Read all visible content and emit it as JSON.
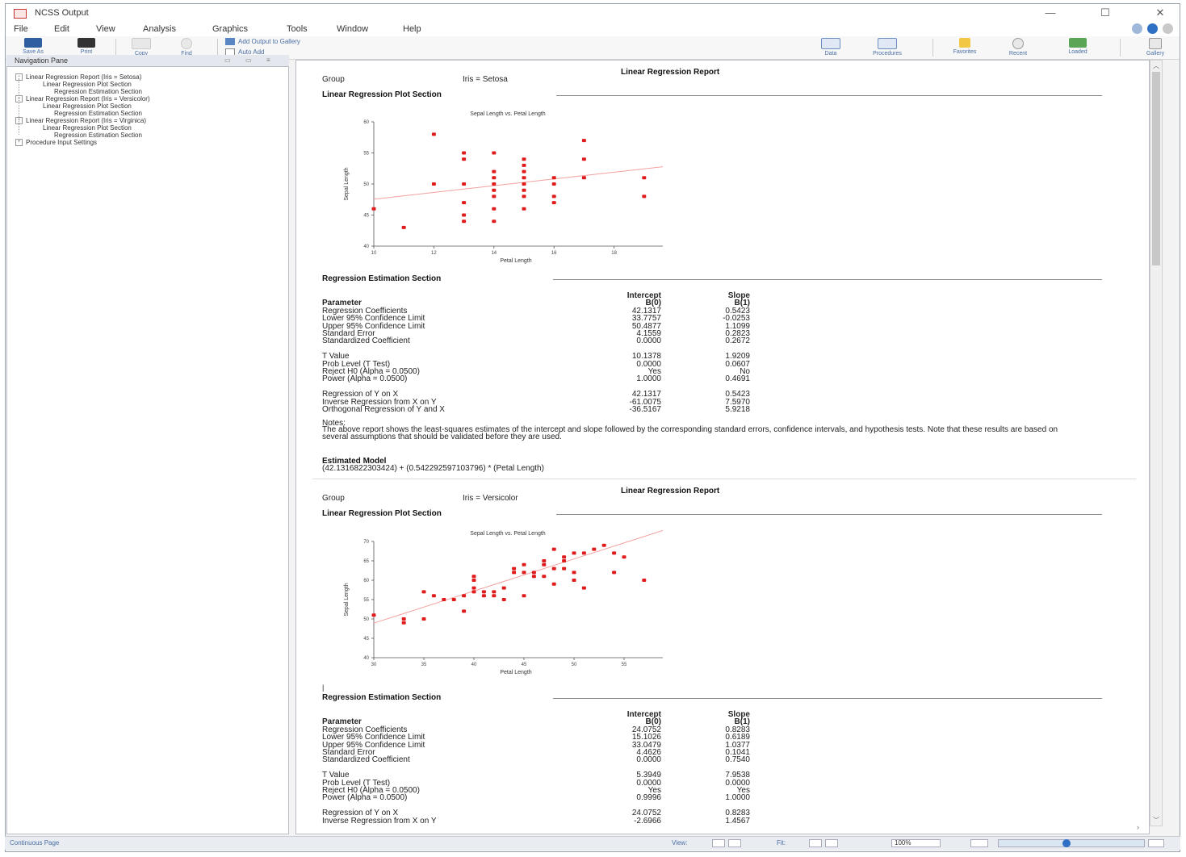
{
  "window": {
    "title": "NCSS Output",
    "controls": [
      "—",
      "☐",
      "✕"
    ]
  },
  "menu": [
    "File",
    "Edit",
    "View",
    "Analysis",
    "Graphics",
    "Tools",
    "Window",
    "Help"
  ],
  "toolbar": {
    "save_as": "Save As",
    "print": "Print",
    "copy": "Copy",
    "find": "Find",
    "add_output": "Add Output to Gallery",
    "auto_add": "Auto Add",
    "data": "Data",
    "procedures": "Procedures",
    "favorites": "Favorites",
    "recent": "Recent",
    "loaded": "Loaded",
    "gallery": "Gallery"
  },
  "nav": {
    "title": "Navigation Pane",
    "items": [
      "Linear Regression Report (Iris = Setosa)",
      "Linear Regression Plot Section",
      "Regression Estimation Section",
      "Linear Regression Report (Iris = Versicolor)",
      "Linear Regression Plot Section",
      "Regression Estimation Section",
      "Linear Regression Report (Iris = Virginica)",
      "Linear Regression Plot Section",
      "Regression Estimation Section",
      "Procedure Input Settings"
    ]
  },
  "reports": [
    {
      "title": "Linear Regression Report",
      "group_label": "Group",
      "group_value": "Iris = Setosa",
      "plot_section": "Linear Regression Plot Section",
      "est_section": "Regression Estimation Section",
      "param_header": "Parameter",
      "col1_header": [
        "Intercept",
        "B(0)"
      ],
      "col2_header": [
        "Slope",
        "B(1)"
      ],
      "rows": [
        [
          "Regression Coefficients",
          "42.1317",
          "0.5423"
        ],
        [
          "Lower 95% Confidence Limit",
          "33.7757",
          "-0.0253"
        ],
        [
          "Upper 95% Confidence Limit",
          "50.4877",
          "1.1099"
        ],
        [
          "Standard Error",
          "4.1559",
          "0.2823"
        ],
        [
          "Standardized Coefficient",
          "0.0000",
          "0.2672"
        ],
        [
          "",
          "",
          ""
        ],
        [
          "T Value",
          "10.1378",
          "1.9209"
        ],
        [
          "Prob Level (T Test)",
          "0.0000",
          "0.0607"
        ],
        [
          "Reject H0 (Alpha = 0.0500)",
          "Yes",
          "No"
        ],
        [
          "Power (Alpha = 0.0500)",
          "1.0000",
          "0.4691"
        ],
        [
          "",
          "",
          ""
        ],
        [
          "Regression of Y on X",
          "42.1317",
          "0.5423"
        ],
        [
          "Inverse Regression from X on Y",
          "-61.0075",
          "7.5970"
        ],
        [
          "Orthogonal Regression of Y and X",
          "-36.5167",
          "5.9218"
        ]
      ],
      "notes_label": "Notes:",
      "notes": "The above report shows the least-squares estimates of the intercept and slope followed by the corresponding standard errors, confidence intervals, and hypothesis tests. Note that these results are based on several assumptions that should be validated before they are used.",
      "model_label": "Estimated Model",
      "model": "(42.1316822303424) + (0.542292597103796) * (Petal Length)"
    },
    {
      "title": "Linear Regression Report",
      "group_label": "Group",
      "group_value": "Iris = Versicolor",
      "plot_section": "Linear Regression Plot Section",
      "est_section": "Regression Estimation Section",
      "param_header": "Parameter",
      "col1_header": [
        "Intercept",
        "B(0)"
      ],
      "col2_header": [
        "Slope",
        "B(1)"
      ],
      "rows": [
        [
          "Regression Coefficients",
          "24.0752",
          "0.8283"
        ],
        [
          "Lower 95% Confidence Limit",
          "15.1026",
          "0.6189"
        ],
        [
          "Upper 95% Confidence Limit",
          "33.0479",
          "1.0377"
        ],
        [
          "Standard Error",
          "4.4626",
          "0.1041"
        ],
        [
          "Standardized Coefficient",
          "0.0000",
          "0.7540"
        ],
        [
          "",
          "",
          ""
        ],
        [
          "T Value",
          "5.3949",
          "7.9538"
        ],
        [
          "Prob Level (T Test)",
          "0.0000",
          "0.0000"
        ],
        [
          "Reject H0 (Alpha = 0.0500)",
          "Yes",
          "Yes"
        ],
        [
          "Power (Alpha = 0.0500)",
          "0.9996",
          "1.0000"
        ],
        [
          "",
          "",
          ""
        ],
        [
          "Regression of Y on X",
          "24.0752",
          "0.8283"
        ],
        [
          "Inverse Regression from X on Y",
          "-2.6966",
          "1.4567"
        ]
      ]
    }
  ],
  "chart_data": [
    {
      "type": "scatter",
      "title": "Sepal Length vs. Petal Length",
      "xlabel": "Petal Length",
      "ylabel": "Sepal Length",
      "xlim": [
        10,
        20
      ],
      "ylim": [
        40,
        60
      ],
      "xticks": [
        10,
        12,
        14,
        16,
        18,
        20
      ],
      "yticks": [
        40,
        45,
        50,
        55,
        60
      ],
      "regression": {
        "intercept": 42.1317,
        "slope": 0.5423
      },
      "points": [
        [
          10,
          46
        ],
        [
          11,
          43
        ],
        [
          12,
          58
        ],
        [
          12,
          50
        ],
        [
          13,
          55
        ],
        [
          13,
          54
        ],
        [
          13,
          50
        ],
        [
          13,
          47
        ],
        [
          13,
          45
        ],
        [
          13,
          44
        ],
        [
          14,
          55
        ],
        [
          14,
          52
        ],
        [
          14,
          51
        ],
        [
          14,
          50
        ],
        [
          14,
          49
        ],
        [
          14,
          48
        ],
        [
          14,
          46
        ],
        [
          14,
          44
        ],
        [
          15,
          54
        ],
        [
          15,
          53
        ],
        [
          15,
          52
        ],
        [
          15,
          51
        ],
        [
          15,
          50
        ],
        [
          15,
          49
        ],
        [
          15,
          48
        ],
        [
          15,
          46
        ],
        [
          16,
          51
        ],
        [
          16,
          50
        ],
        [
          16,
          48
        ],
        [
          16,
          47
        ],
        [
          17,
          57
        ],
        [
          17,
          54
        ],
        [
          17,
          51
        ],
        [
          19,
          51
        ],
        [
          19,
          48
        ]
      ],
      "color": "#e01b1b"
    },
    {
      "type": "scatter",
      "title": "Sepal Length vs. Petal Length",
      "xlabel": "Petal Length",
      "ylabel": "Sepal Length",
      "xlim": [
        30,
        60
      ],
      "ylim": [
        40,
        70
      ],
      "xticks": [
        30,
        35,
        40,
        45,
        50,
        55,
        60
      ],
      "yticks": [
        40,
        45,
        50,
        55,
        60,
        65,
        70
      ],
      "regression": {
        "intercept": 24.0752,
        "slope": 0.8283
      },
      "points": [
        [
          30,
          51
        ],
        [
          33,
          50
        ],
        [
          33,
          49
        ],
        [
          35,
          50
        ],
        [
          35,
          57
        ],
        [
          36,
          56
        ],
        [
          37,
          55
        ],
        [
          38,
          55
        ],
        [
          39,
          56
        ],
        [
          39,
          52
        ],
        [
          40,
          57
        ],
        [
          40,
          58
        ],
        [
          40,
          60
        ],
        [
          40,
          61
        ],
        [
          41,
          56
        ],
        [
          41,
          57
        ],
        [
          42,
          57
        ],
        [
          42,
          56
        ],
        [
          43,
          58
        ],
        [
          43,
          55
        ],
        [
          44,
          62
        ],
        [
          44,
          63
        ],
        [
          45,
          62
        ],
        [
          45,
          64
        ],
        [
          45,
          56
        ],
        [
          46,
          62
        ],
        [
          46,
          61
        ],
        [
          47,
          65
        ],
        [
          47,
          64
        ],
        [
          47,
          61
        ],
        [
          48,
          63
        ],
        [
          48,
          59
        ],
        [
          48,
          68
        ],
        [
          49,
          66
        ],
        [
          49,
          65
        ],
        [
          49,
          63
        ],
        [
          50,
          67
        ],
        [
          50,
          62
        ],
        [
          50,
          60
        ],
        [
          51,
          67
        ],
        [
          51,
          58
        ],
        [
          52,
          68
        ],
        [
          53,
          69
        ],
        [
          54,
          67
        ],
        [
          54,
          62
        ],
        [
          55,
          66
        ],
        [
          57,
          60
        ]
      ],
      "color": "#e01b1b"
    }
  ],
  "status": {
    "mode": "Continuous Page",
    "view": "View:",
    "fit": "Fit:",
    "zoom": "100%"
  }
}
